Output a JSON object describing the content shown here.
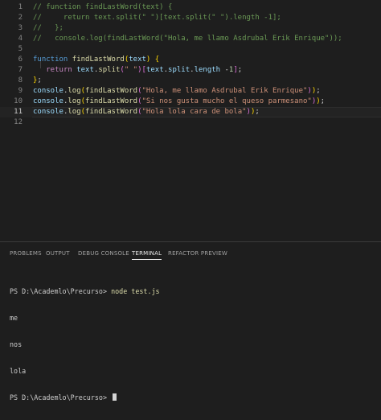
{
  "editor": {
    "line_numbers": [
      "1",
      "2",
      "3",
      "4",
      "5",
      "6",
      "7",
      "8",
      "9",
      "10",
      "11",
      "12"
    ],
    "active_line": "11",
    "lines": [
      [
        {
          "t": "// function findLastWord(text) {",
          "c": "comment"
        }
      ],
      [
        {
          "t": "//     return text.split(\" \")[text.split(\" \").length -1];",
          "c": "comment"
        }
      ],
      [
        {
          "t": "//   };",
          "c": "comment"
        }
      ],
      [
        {
          "t": "//   console.log(findLastWord(\"Hola, me llamo Asdrubal Erik Enrique\"));",
          "c": "comment"
        }
      ],
      [],
      [
        {
          "t": "function ",
          "c": "kw"
        },
        {
          "t": "findLastWord",
          "c": "fn"
        },
        {
          "t": "(",
          "c": "br1"
        },
        {
          "t": "text",
          "c": "var"
        },
        {
          "t": ")",
          "c": "br1"
        },
        {
          "t": " ",
          "c": "plain"
        },
        {
          "t": "{",
          "c": "br1"
        }
      ],
      [
        {
          "t": "   ",
          "c": "plain"
        },
        {
          "t": "return ",
          "c": "ctrl"
        },
        {
          "t": "text",
          "c": "var"
        },
        {
          "t": ".",
          "c": "plain"
        },
        {
          "t": "split",
          "c": "fn"
        },
        {
          "t": "(",
          "c": "br2"
        },
        {
          "t": "\" \"",
          "c": "str"
        },
        {
          "t": ")",
          "c": "br2"
        },
        {
          "t": "[",
          "c": "br2"
        },
        {
          "t": "text",
          "c": "var"
        },
        {
          "t": ".",
          "c": "plain"
        },
        {
          "t": "split",
          "c": "var"
        },
        {
          "t": ".",
          "c": "plain"
        },
        {
          "t": "length",
          "c": "var"
        },
        {
          "t": " -",
          "c": "plain"
        },
        {
          "t": "1",
          "c": "num"
        },
        {
          "t": "]",
          "c": "br2"
        },
        {
          "t": ";",
          "c": "plain"
        }
      ],
      [
        {
          "t": "}",
          "c": "br1"
        },
        {
          "t": ";",
          "c": "plain"
        }
      ],
      [
        {
          "t": "console",
          "c": "var"
        },
        {
          "t": ".",
          "c": "plain"
        },
        {
          "t": "log",
          "c": "fn"
        },
        {
          "t": "(",
          "c": "br1"
        },
        {
          "t": "findLastWord",
          "c": "fn"
        },
        {
          "t": "(",
          "c": "br2"
        },
        {
          "t": "\"Hola, me llamo Asdrubal Erik Enrique\"",
          "c": "str"
        },
        {
          "t": ")",
          "c": "br2"
        },
        {
          "t": ")",
          "c": "br1"
        },
        {
          "t": ";",
          "c": "plain"
        }
      ],
      [
        {
          "t": "console",
          "c": "var"
        },
        {
          "t": ".",
          "c": "plain"
        },
        {
          "t": "log",
          "c": "fn"
        },
        {
          "t": "(",
          "c": "br1"
        },
        {
          "t": "findLastWord",
          "c": "fn"
        },
        {
          "t": "(",
          "c": "br2"
        },
        {
          "t": "\"Si nos gusta mucho el queso parmesano\"",
          "c": "str"
        },
        {
          "t": ")",
          "c": "br2"
        },
        {
          "t": ")",
          "c": "br1"
        },
        {
          "t": ";",
          "c": "plain"
        }
      ],
      [
        {
          "t": "console",
          "c": "var"
        },
        {
          "t": ".",
          "c": "plain"
        },
        {
          "t": "log",
          "c": "fn"
        },
        {
          "t": "(",
          "c": "br1"
        },
        {
          "t": "findLastWord",
          "c": "fn"
        },
        {
          "t": "(",
          "c": "br2"
        },
        {
          "t": "\"Hola lola cara de bola\"",
          "c": "str"
        },
        {
          "t": ")",
          "c": "br2"
        },
        {
          "t": ")",
          "c": "br1"
        },
        {
          "t": ";",
          "c": "plain"
        }
      ],
      []
    ]
  },
  "panel": {
    "tabs": [
      {
        "label": "PROBLEMS",
        "active": false
      },
      {
        "label": "OUTPUT",
        "active": false
      },
      {
        "label": "DEBUG CONSOLE",
        "active": false
      },
      {
        "label": "TERMINAL",
        "active": true
      },
      {
        "label": "REFACTOR PREVIEW",
        "active": false
      }
    ],
    "terminal": {
      "prompt": "PS D:\\Academlo\\Precurso>",
      "command": "node test.js",
      "output": [
        "me",
        "nos",
        "lola"
      ]
    }
  },
  "colors": {
    "editor_bg": "#1e1e1e",
    "comment": "#6a9955",
    "keyword": "#569cd6",
    "function": "#dcdcaa",
    "variable": "#9cdcfe",
    "string": "#ce9178"
  }
}
